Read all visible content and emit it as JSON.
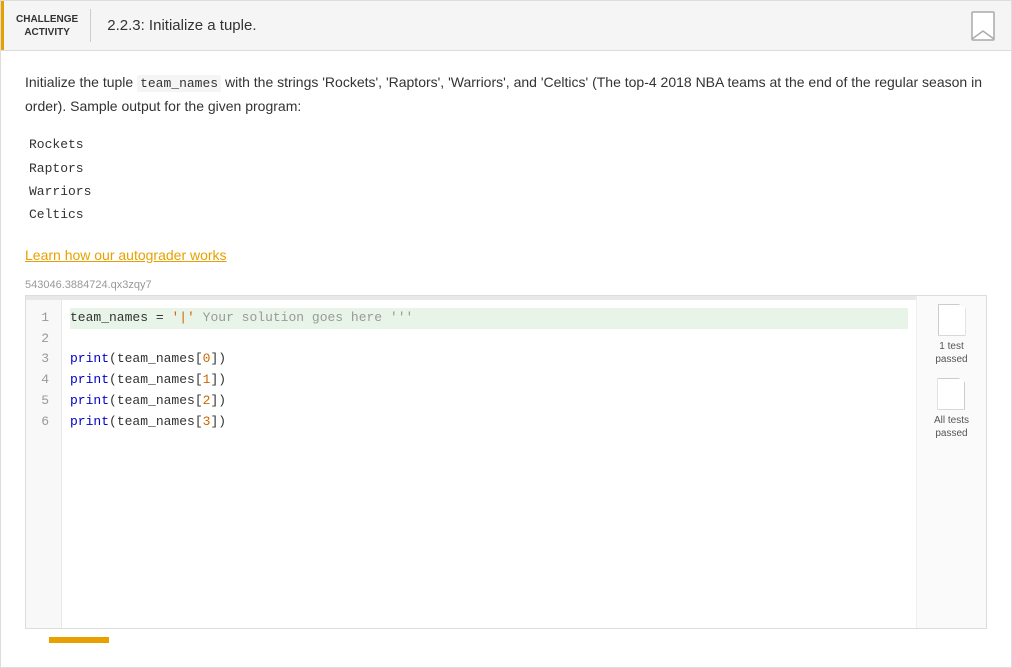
{
  "header": {
    "challenge_label_line1": "CHALLENGE",
    "challenge_label_line2": "ACTIVITY",
    "title": "2.2.3: Initialize a tuple."
  },
  "description": {
    "text_before_code": "Initialize the tuple ",
    "inline_code": "team_names",
    "text_after_code": " with the strings 'Rockets', 'Raptors', 'Warriors', and 'Celtics' (The top-4 2018 NBA teams at the end of the regular season in order). Sample output for the given program:"
  },
  "sample_output": {
    "lines": [
      "Rockets",
      "Raptors",
      "Warriors",
      "Celtics"
    ]
  },
  "autograder_link": "Learn how our autograder works",
  "submission_id": "543046.3884724.qx3zqy7",
  "code": {
    "lines": [
      {
        "num": 1,
        "highlighted": true
      },
      {
        "num": 2,
        "highlighted": false
      },
      {
        "num": 3,
        "highlighted": false
      },
      {
        "num": 4,
        "highlighted": false
      },
      {
        "num": 5,
        "highlighted": false
      },
      {
        "num": 6,
        "highlighted": false
      }
    ]
  },
  "test_badges": [
    {
      "label": "1 test\npassed"
    },
    {
      "label": "All tests\npassed"
    }
  ]
}
